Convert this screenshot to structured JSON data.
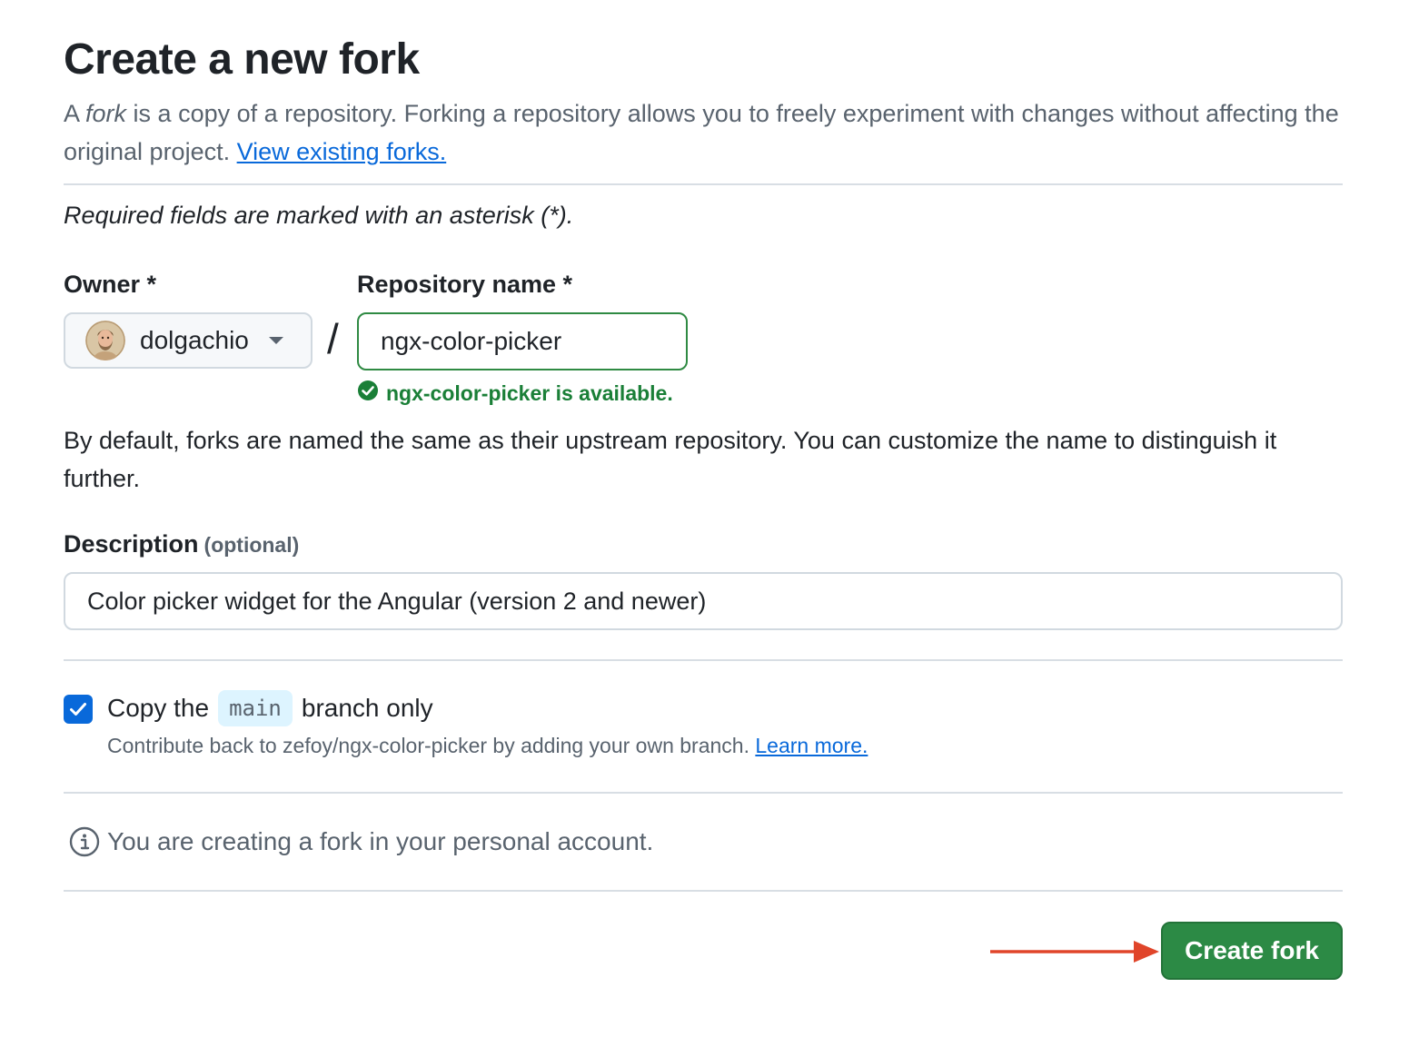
{
  "header": {
    "title": "Create a new fork",
    "intro_a": "A ",
    "intro_em": "fork",
    "intro_b": " is a copy of a repository. Forking a repository allows you to freely experiment with changes without affecting the original project. ",
    "view_forks_link": "View existing forks."
  },
  "required_note": "Required fields are marked with an asterisk (*).",
  "owner": {
    "label": "Owner *",
    "selected": "dolgachio",
    "avatar_icon": "user-avatar"
  },
  "separator": "/",
  "repository": {
    "label": "Repository name *",
    "value": "ngx-color-picker",
    "availability": "ngx-color-picker is available.",
    "status_color": "#1a7f37"
  },
  "default_note": "By default, forks are named the same as their upstream repository. You can customize the name to distinguish it further.",
  "description": {
    "label": "Description",
    "optional": "(optional)",
    "value": "Color picker widget for the Angular (version 2 and newer)"
  },
  "branch_option": {
    "checked": true,
    "label_before": "Copy the",
    "branch": "main",
    "label_after": "branch only",
    "help": "Contribute back to zefoy/ngx-color-picker by adding your own branch. ",
    "learn_more": "Learn more."
  },
  "info": {
    "icon": "info-icon",
    "text": "You are creating a fork in your personal account."
  },
  "actions": {
    "create_button": "Create fork",
    "button_color": "#2c8a45",
    "annotation_color": "#e0452a"
  }
}
